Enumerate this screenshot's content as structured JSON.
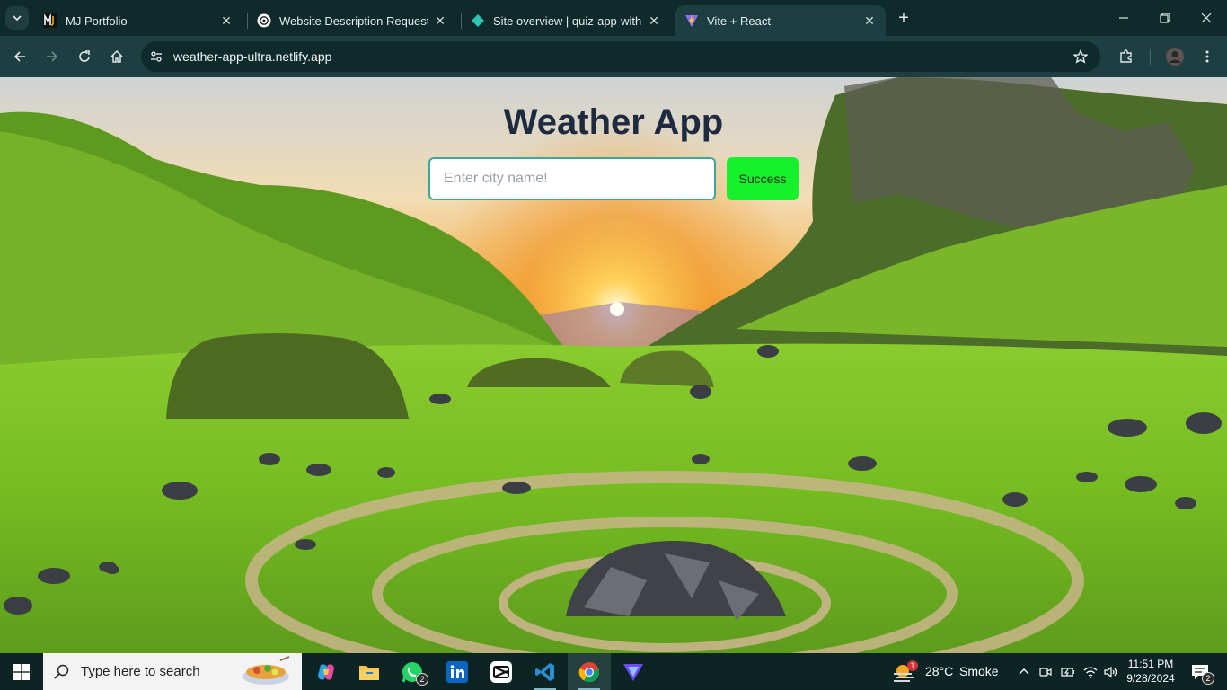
{
  "browser": {
    "tabs": [
      {
        "title": "MJ Portfolio",
        "active": false
      },
      {
        "title": "Website Description Request",
        "active": false
      },
      {
        "title": "Site overview | quiz-app-with-re",
        "active": false
      },
      {
        "title": "Vite + React",
        "active": true
      }
    ],
    "url": "weather-app-ultra.netlify.app"
  },
  "app": {
    "title": "Weather App",
    "search_placeholder": "Enter city name!",
    "search_value": "",
    "button_label": "Success",
    "button_color": "#17f12d",
    "title_color": "#1d2a3f"
  },
  "taskbar": {
    "search_placeholder": "Type here to search",
    "whatsapp_badge": "2",
    "weather_badge": "1",
    "weather_temp": "28°C",
    "weather_desc": "Smoke",
    "time": "11:51 PM",
    "date": "9/28/2024",
    "notification_count": "2"
  }
}
